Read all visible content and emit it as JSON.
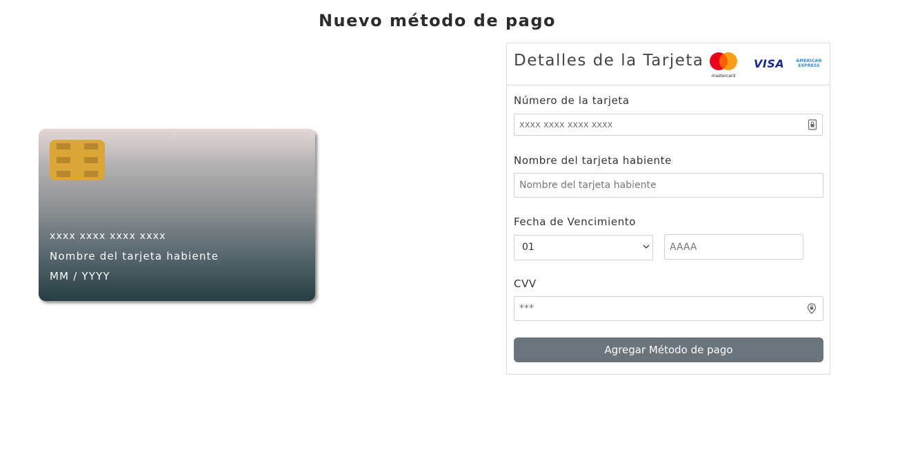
{
  "page": {
    "title": "Nuevo método de pago"
  },
  "card_preview": {
    "number": "xxxx xxxx xxxx xxxx",
    "holder": "Nombre del tarjeta habiente",
    "expiry": "MM / YYYY"
  },
  "form": {
    "title": "Detalles de la Tarjeta",
    "brands": {
      "mastercard": "mastercard",
      "visa": "VISA",
      "amex_line1": "AMERICAN",
      "amex_line2": "EXPRESS"
    },
    "card_number": {
      "label": "Número de la tarjeta",
      "placeholder": "xxxx xxxx xxxx xxxx",
      "icon": "card-lock-icon"
    },
    "holder_name": {
      "label": "Nombre del tarjeta habiente",
      "placeholder": "Nombre del tarjeta habiente"
    },
    "expiry": {
      "label": "Fecha de Vencimiento",
      "month_selected": "01",
      "year_placeholder": "AAAA"
    },
    "cvv": {
      "label": "CVV",
      "placeholder": "***",
      "icon": "location-lock-icon"
    },
    "submit_label": "Agregar Método de pago"
  },
  "colors": {
    "card_gradient_top": "#e4d7d6",
    "card_gradient_bottom": "#263d42",
    "chip": "#d9a637",
    "button": "#6b737b"
  }
}
